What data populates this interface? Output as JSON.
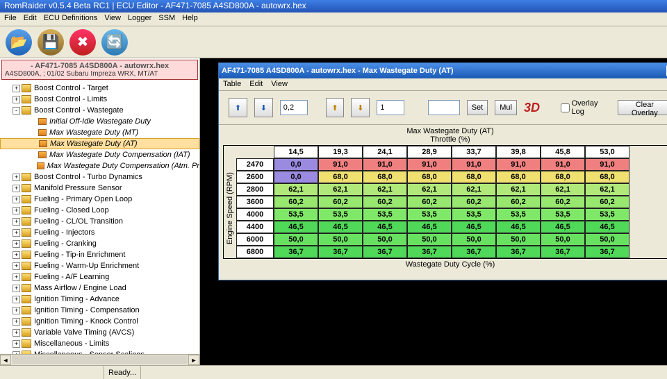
{
  "title": "RomRaider v0.5.4 Beta RC1 | ECU Editor - AF471-7085 A4SD800A - autowrx.hex",
  "menus": [
    "File",
    "Edit",
    "ECU Definitions",
    "View",
    "Logger",
    "SSM",
    "Help"
  ],
  "left": {
    "title": "- AF471-7085 A4SD800A - autowrx.hex",
    "subtitle": "A4SD800A, ; 01/02 Subaru Impreza WRX, MT/AT",
    "tree": [
      {
        "d": 1,
        "exp": "+",
        "ico": "f",
        "label": "Boost Control - Target"
      },
      {
        "d": 1,
        "exp": "+",
        "ico": "f",
        "label": "Boost Control - Limits"
      },
      {
        "d": 1,
        "exp": "-",
        "ico": "f",
        "label": "Boost Control - Wastegate"
      },
      {
        "d": 2,
        "ico": "t",
        "label": "Initial Off-Idle Wastegate Duty",
        "it": true
      },
      {
        "d": 2,
        "ico": "t",
        "label": "Max Wastegate Duty (MT)",
        "it": true
      },
      {
        "d": 2,
        "ico": "t",
        "label": "Max Wastegate Duty (AT)",
        "it": true,
        "sel": true
      },
      {
        "d": 2,
        "ico": "t",
        "label": "Max Wastegate Duty Compensation (IAT)",
        "it": true
      },
      {
        "d": 2,
        "ico": "t",
        "label": "Max Wastegate Duty Compensation (Atm. Pr",
        "it": true
      },
      {
        "d": 1,
        "exp": "+",
        "ico": "f",
        "label": "Boost Control - Turbo Dynamics"
      },
      {
        "d": 1,
        "exp": "+",
        "ico": "f",
        "label": "Manifold Pressure Sensor"
      },
      {
        "d": 1,
        "exp": "+",
        "ico": "f",
        "label": "Fueling - Primary Open Loop"
      },
      {
        "d": 1,
        "exp": "+",
        "ico": "f",
        "label": "Fueling - Closed Loop"
      },
      {
        "d": 1,
        "exp": "+",
        "ico": "f",
        "label": "Fueling - CL/OL Transition"
      },
      {
        "d": 1,
        "exp": "+",
        "ico": "f",
        "label": "Fueling - Injectors"
      },
      {
        "d": 1,
        "exp": "+",
        "ico": "f",
        "label": "Fueling - Cranking"
      },
      {
        "d": 1,
        "exp": "+",
        "ico": "f",
        "label": "Fueling - Tip-in Enrichment"
      },
      {
        "d": 1,
        "exp": "+",
        "ico": "f",
        "label": "Fueling - Warm-Up Enrichment"
      },
      {
        "d": 1,
        "exp": "+",
        "ico": "f",
        "label": "Fueling - A/F Learning"
      },
      {
        "d": 1,
        "exp": "+",
        "ico": "f",
        "label": "Mass Airflow / Engine Load"
      },
      {
        "d": 1,
        "exp": "+",
        "ico": "f",
        "label": "Ignition Timing - Advance"
      },
      {
        "d": 1,
        "exp": "+",
        "ico": "f",
        "label": "Ignition Timing - Compensation"
      },
      {
        "d": 1,
        "exp": "+",
        "ico": "f",
        "label": "Ignition Timing - Knock Control"
      },
      {
        "d": 1,
        "exp": "+",
        "ico": "f",
        "label": "Variable Valve Timing (AVCS)"
      },
      {
        "d": 1,
        "exp": "+",
        "ico": "f",
        "label": "Miscellaneous - Limits"
      },
      {
        "d": 1,
        "exp": "+",
        "ico": "f",
        "label": "Miscellaneous - Sensor Scalings"
      }
    ]
  },
  "panel": {
    "title": "AF471-7085 A4SD800A - autowrx.hex - Max Wastegate Duty (AT)",
    "menus": [
      "Table",
      "Edit",
      "View"
    ],
    "step1": "0,2",
    "step2": "1",
    "set": "Set",
    "mul": "Mul",
    "threed": "3D",
    "overlay": "Overlay Log",
    "clear": "Clear Overlay",
    "table_title": "Max Wastegate Duty (AT)",
    "x_axis": "Throttle (%)",
    "y_label": "Engine Speed (RPM)",
    "x_footer": "Wastegate Duty Cycle (%)"
  },
  "status": "Ready...",
  "chart_data": {
    "type": "heatmap",
    "title": "Max Wastegate Duty (AT)",
    "xlabel": "Throttle (%)",
    "ylabel": "Engine Speed (RPM)",
    "x": [
      "14,5",
      "19,3",
      "24,1",
      "28,9",
      "33,7",
      "39,8",
      "45,8",
      "53,0"
    ],
    "y": [
      "2470",
      "2600",
      "2800",
      "3600",
      "4000",
      "4400",
      "6000",
      "6800"
    ],
    "rows": [
      [
        "0,0",
        "91,0",
        "91,0",
        "91,0",
        "91,0",
        "91,0",
        "91,0",
        "91,0"
      ],
      [
        "0,0",
        "68,0",
        "68,0",
        "68,0",
        "68,0",
        "68,0",
        "68,0",
        "68,0"
      ],
      [
        "62,1",
        "62,1",
        "62,1",
        "62,1",
        "62,1",
        "62,1",
        "62,1",
        "62,1"
      ],
      [
        "60,2",
        "60,2",
        "60,2",
        "60,2",
        "60,2",
        "60,2",
        "60,2",
        "60,2"
      ],
      [
        "53,5",
        "53,5",
        "53,5",
        "53,5",
        "53,5",
        "53,5",
        "53,5",
        "53,5"
      ],
      [
        "46,5",
        "46,5",
        "46,5",
        "46,5",
        "46,5",
        "46,5",
        "46,5",
        "46,5"
      ],
      [
        "50,0",
        "50,0",
        "50,0",
        "50,0",
        "50,0",
        "50,0",
        "50,0",
        "50,0"
      ],
      [
        "36,7",
        "36,7",
        "36,7",
        "36,7",
        "36,7",
        "36,7",
        "36,7",
        "36,7"
      ]
    ],
    "colors": [
      [
        "c-purple",
        "c-red",
        "c-red",
        "c-red",
        "c-red",
        "c-red",
        "c-red",
        "c-red"
      ],
      [
        "c-purple",
        "c-yellow",
        "c-yellow",
        "c-yellow",
        "c-yellow",
        "c-yellow",
        "c-yellow",
        "c-yellow"
      ],
      [
        "c-green1",
        "c-green1",
        "c-green1",
        "c-green1",
        "c-green1",
        "c-green1",
        "c-green1",
        "c-green1"
      ],
      [
        "c-green2",
        "c-green2",
        "c-green2",
        "c-green2",
        "c-green2",
        "c-green2",
        "c-green2",
        "c-green2"
      ],
      [
        "c-green3",
        "c-green3",
        "c-green3",
        "c-green3",
        "c-green3",
        "c-green3",
        "c-green3",
        "c-green3"
      ],
      [
        "c-green5",
        "c-green5",
        "c-green5",
        "c-green5",
        "c-green5",
        "c-green5",
        "c-green5",
        "c-green5"
      ],
      [
        "c-green4",
        "c-green4",
        "c-green4",
        "c-green4",
        "c-green4",
        "c-green4",
        "c-green4",
        "c-green4"
      ],
      [
        "c-green5",
        "c-green5",
        "c-green5",
        "c-green5",
        "c-green5",
        "c-green5",
        "c-green5",
        "c-green5"
      ]
    ]
  }
}
